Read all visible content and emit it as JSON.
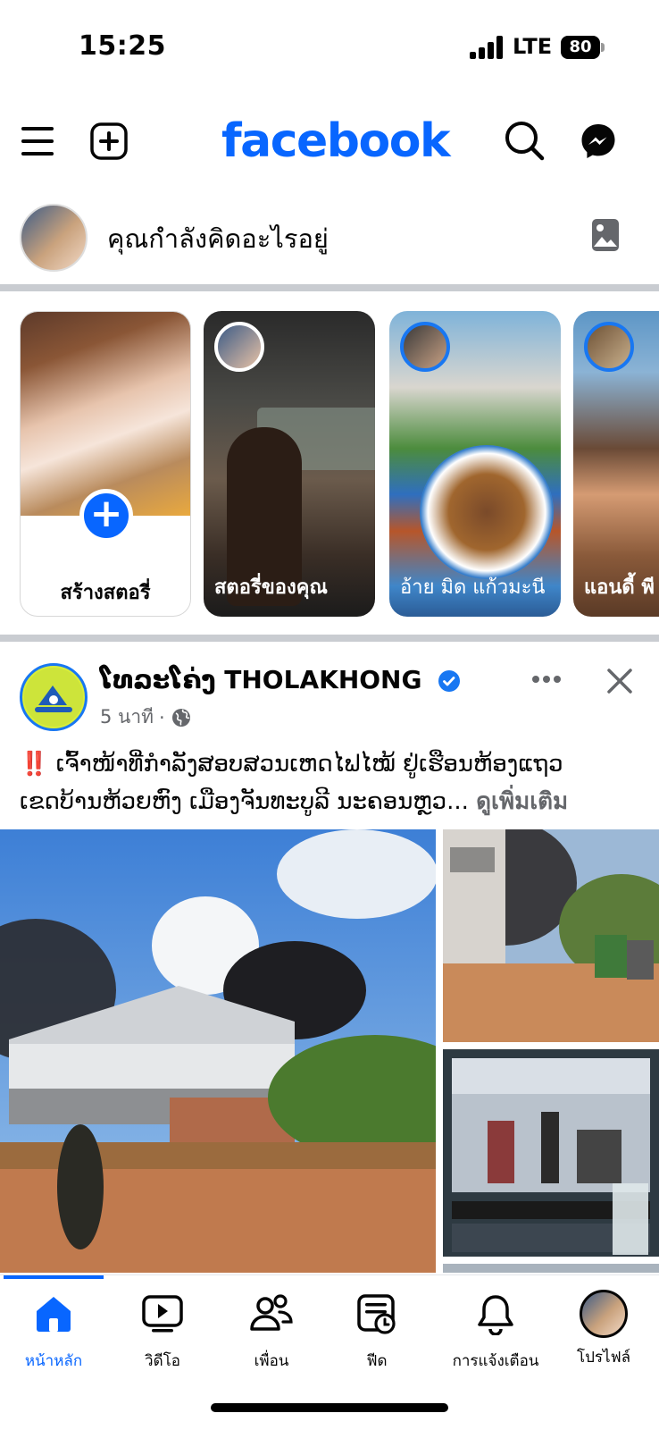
{
  "status": {
    "time": "15:25",
    "network": "LTE",
    "battery": "80"
  },
  "header": {
    "brand": "facebook"
  },
  "composer": {
    "placeholder": "คุณกำลังคิดอะไรอยู่"
  },
  "stories": [
    {
      "label": "สร้างสตอรี่",
      "type": "create"
    },
    {
      "label": "สตอรี่ของคุณ",
      "type": "own"
    },
    {
      "label": "อ้าย มิด แก้วมะนี",
      "type": "friend"
    },
    {
      "label": "แอนดี้ พี",
      "type": "friend"
    }
  ],
  "post": {
    "page_name": "ໂທລະໂຄ່ງ THOLAKHONG",
    "time": "5 นาที",
    "dot": "·",
    "text_line1": "‼️ ເຈົ້າໜ້າທີ່ກຳລັງສອບສວນເຫດໄຟໄໝ້ ຢູ່ເຮືອນຫ້ອງແຖວ",
    "text_line2": "ເຂດບ້ານຫ້ວຍຫົງ ເມືອງຈັນທະບູລີ ນະຄອນຫຼວ...",
    "see_more": "ดูเพิ่มเติม"
  },
  "tabs": [
    {
      "label": "หน้าหลัก",
      "icon": "home-icon",
      "active": true
    },
    {
      "label": "วิดีโอ",
      "icon": "video-icon",
      "active": false
    },
    {
      "label": "เพื่อน",
      "icon": "friends-icon",
      "active": false
    },
    {
      "label": "ฟีด",
      "icon": "feed-icon",
      "active": false
    },
    {
      "label": "การแจ้งเตือน",
      "icon": "bell-icon",
      "active": false
    },
    {
      "label": "โปรไฟล์",
      "icon": "profile-icon",
      "active": false
    }
  ],
  "colors": {
    "brand": "#0866ff",
    "text": "#050505",
    "secondary": "#65676b",
    "divider": "#c9ccd1"
  }
}
